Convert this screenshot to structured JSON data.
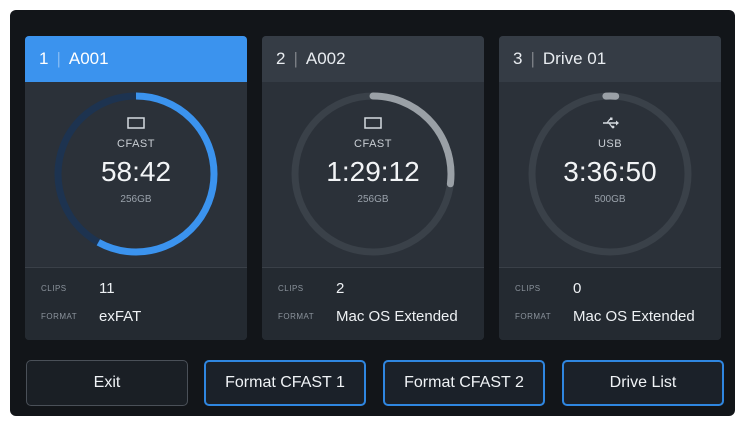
{
  "cards": [
    {
      "num": "1",
      "name": "A001",
      "type": "CFAST",
      "time": "58:42",
      "capacity": "256GB",
      "clips_label": "CLIPS",
      "clips": "11",
      "format_label": "FORMAT",
      "format": "exFAT",
      "used_fraction": 0.58,
      "active": true,
      "icon": "card-icon"
    },
    {
      "num": "2",
      "name": "A002",
      "type": "CFAST",
      "time": "1:29:12",
      "capacity": "256GB",
      "clips_label": "CLIPS",
      "clips": "2",
      "format_label": "FORMAT",
      "format": "Mac OS Extended",
      "used_fraction": 0.27,
      "active": false,
      "icon": "card-icon"
    },
    {
      "num": "3",
      "name": "Drive 01",
      "type": "USB",
      "time": "3:36:50",
      "capacity": "500GB",
      "clips_label": "CLIPS",
      "clips": "0",
      "format_label": "FORMAT",
      "format": "Mac OS Extended",
      "used_fraction": 0.02,
      "active": false,
      "icon": "usb-icon"
    }
  ],
  "buttons": {
    "exit": "Exit",
    "format1": "Format CFAST 1",
    "format2": "Format CFAST 2",
    "drive_list": "Drive List"
  },
  "colors": {
    "accent": "#3b93ee",
    "ring_track": "#1d3350",
    "ring_inactive": "#3a4149",
    "ring_fill_inactive": "#9aa0a6"
  }
}
